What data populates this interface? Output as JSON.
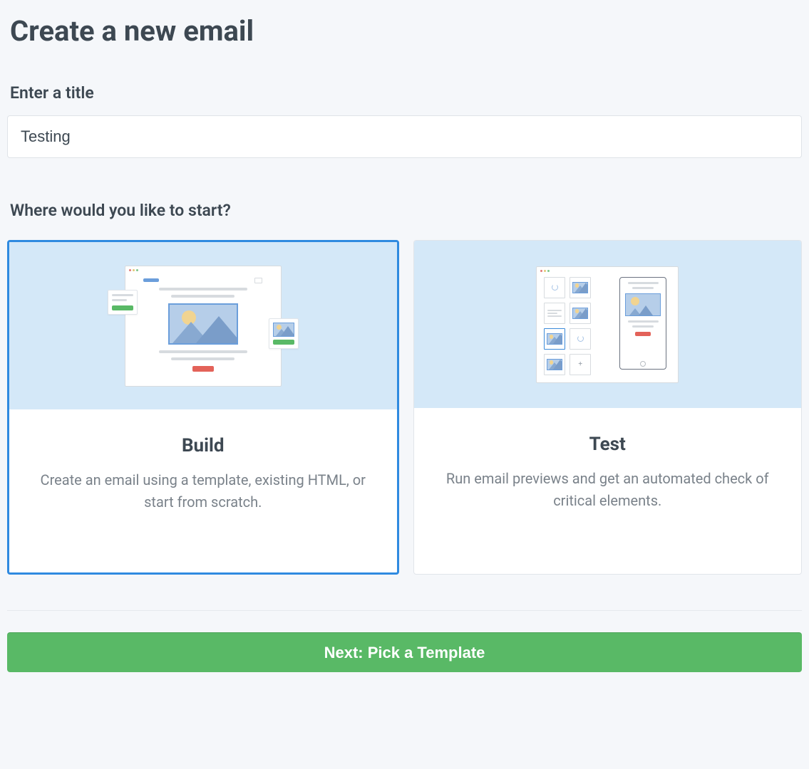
{
  "page": {
    "title": "Create a new email"
  },
  "title_section": {
    "label": "Enter a title",
    "value": "Testing"
  },
  "start_section": {
    "label": "Where would you like to start?"
  },
  "options": {
    "build": {
      "title": "Build",
      "description": "Create an email using a template, existing HTML, or start from scratch.",
      "selected": true
    },
    "test": {
      "title": "Test",
      "description": "Run email previews and get an automated check of critical elements.",
      "selected": false
    }
  },
  "footer": {
    "next_button_label": "Next: Pick a Template"
  },
  "colors": {
    "accent_blue": "#2f8ae0",
    "illustration_bg": "#d4e8f8",
    "button_green": "#59b966"
  }
}
